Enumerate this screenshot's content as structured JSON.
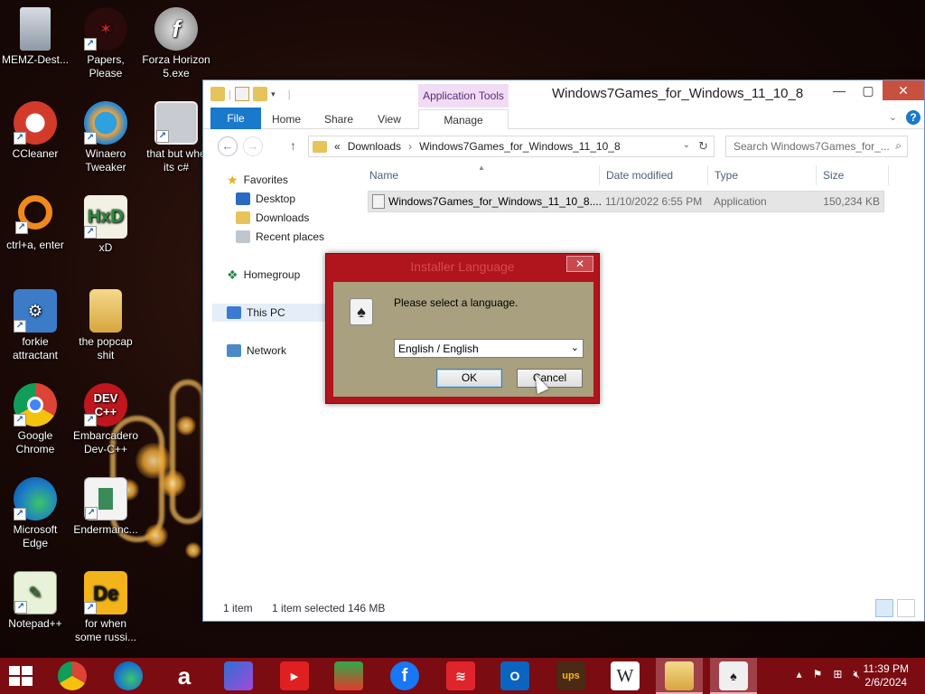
{
  "desktop": {
    "icons": [
      {
        "label": "MEMZ-Dest...",
        "name": "recycle-bin-icon"
      },
      {
        "label": "Papers, Please",
        "name": "papers-please-icon"
      },
      {
        "label": "Forza Horizon 5.exe",
        "name": "flash-icon"
      },
      {
        "label": "CCleaner",
        "name": "ccleaner-icon"
      },
      {
        "label": "Winaero Tweaker",
        "name": "winaero-icon"
      },
      {
        "label": "that but whe its c#",
        "name": "windows-stack-icon"
      },
      {
        "label": "ctrl+a, enter",
        "name": "ring-icon"
      },
      {
        "label": "xD",
        "name": "hxd-icon"
      },
      {
        "label": "forkie attractant",
        "name": "monitor-gear-icon"
      },
      {
        "label": "the popcap shit",
        "name": "folder-icon"
      },
      {
        "label": "Google Chrome",
        "name": "chrome-icon"
      },
      {
        "label": "Embarcadero Dev-C++",
        "name": "devcpp-icon"
      },
      {
        "label": "Microsoft Edge",
        "name": "edge-icon"
      },
      {
        "label": "Endermanc...",
        "name": "document-icon"
      },
      {
        "label": "Notepad++",
        "name": "notepadpp-icon"
      },
      {
        "label": "for when some russi...",
        "name": "de-icon"
      }
    ]
  },
  "explorer": {
    "title": "Windows7Games_for_Windows_11_10_8",
    "context_tab": "Application Tools",
    "ribbon_tabs": [
      "File",
      "Home",
      "Share",
      "View",
      "Manage"
    ],
    "address": {
      "prefix": "«",
      "crumbs": [
        "Downloads",
        "Windows7Games_for_Windows_11_10_8"
      ],
      "separator": "›"
    },
    "search_placeholder": "Search Windows7Games_for_...",
    "nav": {
      "favorites": "Favorites",
      "desktop": "Desktop",
      "downloads": "Downloads",
      "recent": "Recent places",
      "homegroup": "Homegroup",
      "thispc": "This PC",
      "network": "Network"
    },
    "columns": {
      "name": "Name",
      "date": "Date modified",
      "type": "Type",
      "size": "Size"
    },
    "file": {
      "name": "Windows7Games_for_Windows_11_10_8....",
      "date": "11/10/2022 6:55 PM",
      "type": "Application",
      "size": "150,234 KB"
    },
    "status": {
      "count": "1 item",
      "selected": "1 item selected  146 MB"
    }
  },
  "dialog": {
    "title": "Installer Language",
    "prompt": "Please select a language.",
    "selected_language": "English / English",
    "ok_label": "OK",
    "cancel_label": "Cancel",
    "close_glyph": "✕"
  },
  "taskbar": {
    "clock_time": "11:39 PM",
    "clock_date": "2/6/2024"
  }
}
